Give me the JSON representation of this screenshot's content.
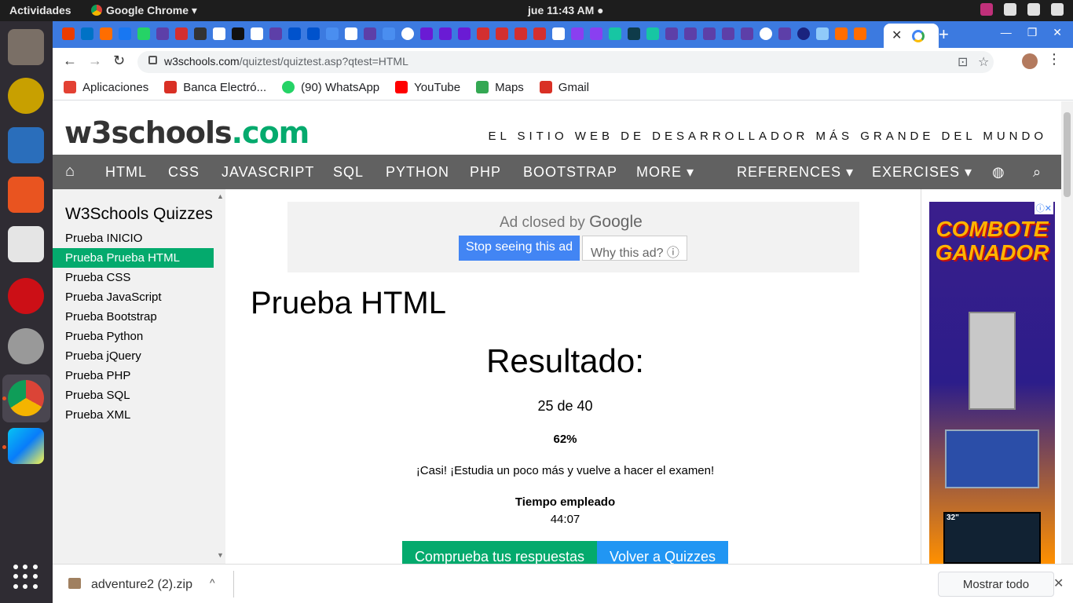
{
  "system": {
    "activities": "Actividades",
    "app_name": "Google Chrome",
    "app_arrow": "▾",
    "clock": "jue 11:43 AM ●"
  },
  "browser": {
    "url_host": "w3schools.com",
    "url_path": "/quiztest/quiztest.asp?qtest=HTML",
    "tab_close": "✕",
    "new_tab": "+",
    "min": "—",
    "max": "❐",
    "close": "✕"
  },
  "bookmarks": [
    {
      "label": "Aplicaciones",
      "color": "#e34133"
    },
    {
      "label": "Banca Electró...",
      "color": "#d93025"
    },
    {
      "label": "(90) WhatsApp",
      "color": "#25d366"
    },
    {
      "label": "YouTube",
      "color": "#ff0000"
    },
    {
      "label": "Maps",
      "color": "#34a853"
    },
    {
      "label": "Gmail",
      "color": "#d93025"
    }
  ],
  "site": {
    "logo_main": "w3schools",
    "logo_dom": ".com",
    "tagline": "EL SITIO WEB DE DESARROLLADOR MÁS GRANDE DEL MUNDO",
    "nav": [
      "HTML",
      "CSS",
      "JAVASCRIPT",
      "SQL",
      "PYTHON",
      "PHP",
      "BOOTSTRAP",
      "MORE ▾",
      "REFERENCES ▾",
      "EXERCISES ▾"
    ],
    "accent": "#04aa6d"
  },
  "sidebar": {
    "title": "W3Schools Quizzes",
    "links": [
      "Prueba INICIO",
      "Prueba Prueba HTML",
      "Prueba CSS",
      "Prueba JavaScript",
      "Prueba Bootstrap",
      "Prueba Python",
      "Prueba jQuery",
      "Prueba PHP",
      "Prueba SQL",
      "Prueba XML"
    ],
    "active_index": 1
  },
  "ad": {
    "closed_prefix": "Ad closed by",
    "closed_brand": "Google",
    "stop": "Stop seeing this ad",
    "why": "Why this ad? ⓘ"
  },
  "main": {
    "title": "Prueba HTML",
    "result_heading": "Resultado:",
    "score": "25 de 40",
    "percent": "62%",
    "message": "¡Casi! ¡Estudia un poco más y vuelve a hacer el examen!",
    "time_label": "Tiempo empleado",
    "time_value": "44:07",
    "btn_check": "Comprueba tus respuestas",
    "btn_back": "Volver a Quizzes"
  },
  "banner": {
    "title": "COMBOTE GANADOR",
    "tv_size": "32\"",
    "ad_choices": "ⓘ✕"
  },
  "download": {
    "filename": "adventure2 (2).zip",
    "show_all": "Mostrar todo",
    "close": "✕",
    "chevron": "^"
  }
}
